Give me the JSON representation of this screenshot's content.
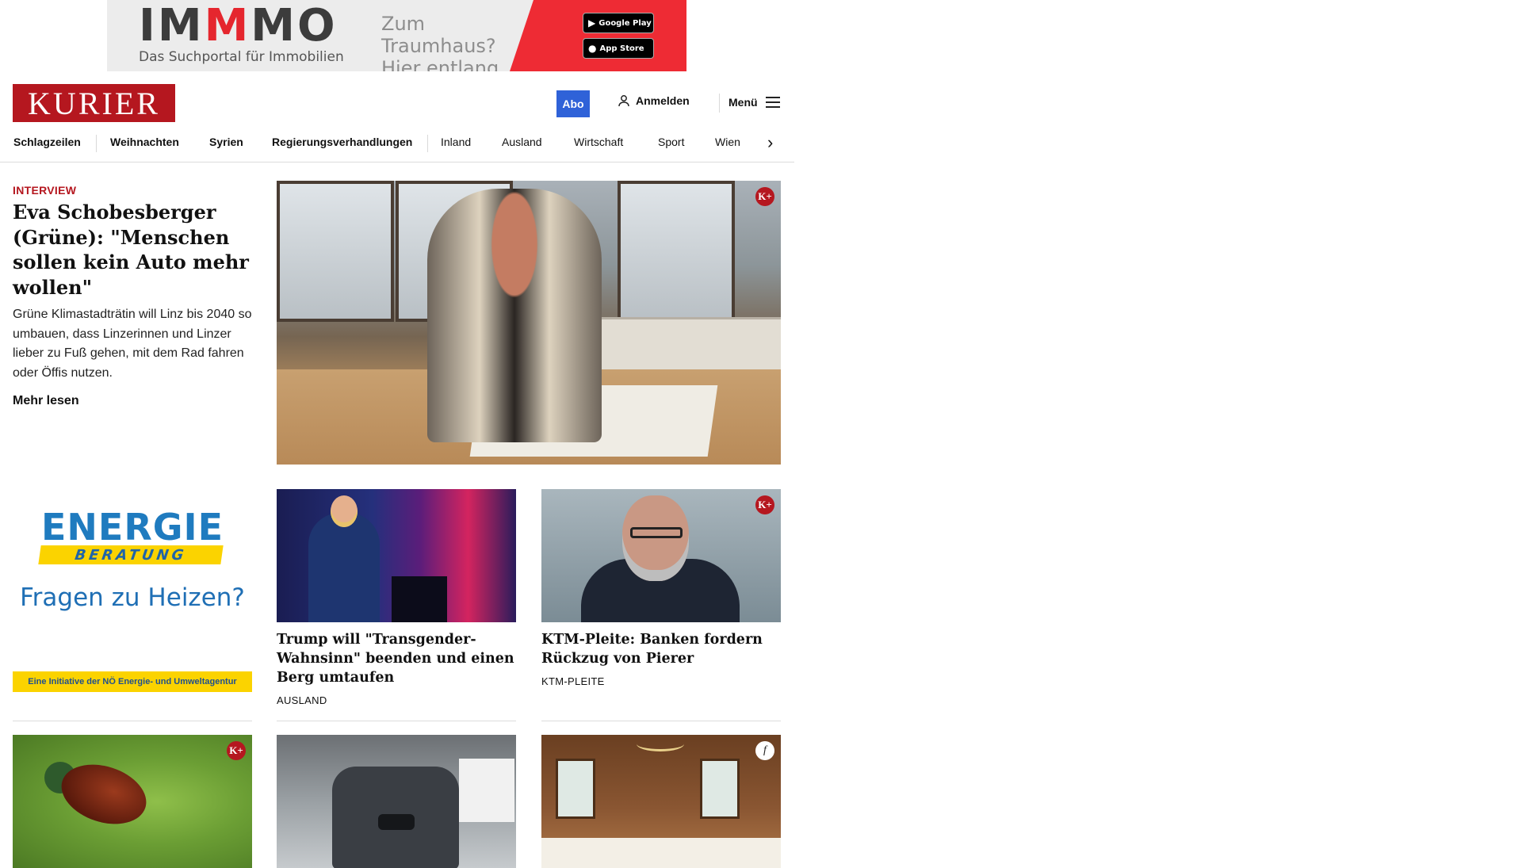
{
  "top_ad": {
    "logo_parts": [
      "IM",
      "M",
      "MO"
    ],
    "subline": "Das Suchportal für Immobilien",
    "claim_line1": "Zum Traumhaus?",
    "claim_line2": "Hier entlang.",
    "google_play": "Google Play",
    "app_store": "App Store",
    "accent_color": "#ee2b34"
  },
  "header": {
    "logo": "KURIER",
    "abo_label": "Abo",
    "login_label": "Anmelden",
    "menu_label": "Menü",
    "brand_color": "#b5171f"
  },
  "nav": {
    "items": [
      "Schlagzeilen",
      "Weihnachten",
      "Syrien",
      "Regierungsverhandlungen",
      "Inland",
      "Ausland",
      "Wirtschaft",
      "Sport",
      "Wien"
    ],
    "next_icon": "chevron-right-icon"
  },
  "lead": {
    "kicker": "INTERVIEW",
    "title": "Eva Schobesberger (Grüne): \"Menschen sollen kein Auto mehr wollen\"",
    "teaser": "Grüne Klimastadträtin will Linz bis 2040 so umbauen, dass Linzerinnen und Linzer lieber zu Fuß gehen, mit dem Rad fahren oder Öffis nutzen.",
    "more": "Mehr lesen",
    "badge": "K+"
  },
  "energie_ad": {
    "logo_line1": "ENERGIE",
    "logo_line2": "BERATUNG",
    "question": "Fragen zu Heizen?",
    "footer": "Eine Initiative der NÖ Energie- und Umweltagentur"
  },
  "cards": [
    {
      "title": "Trump will \"Transgender-Wahnsinn\" beenden und einen Berg umtaufen",
      "category": "AUSLAND"
    },
    {
      "title": "KTM-Pleite: Banken fordern Rückzug von Pierer",
      "category": "KTM-PLEITE",
      "badge": "K+"
    }
  ],
  "bottom_cards": [
    {
      "badge": "K+"
    },
    {
      "badge": ""
    },
    {
      "badge": "f"
    }
  ]
}
